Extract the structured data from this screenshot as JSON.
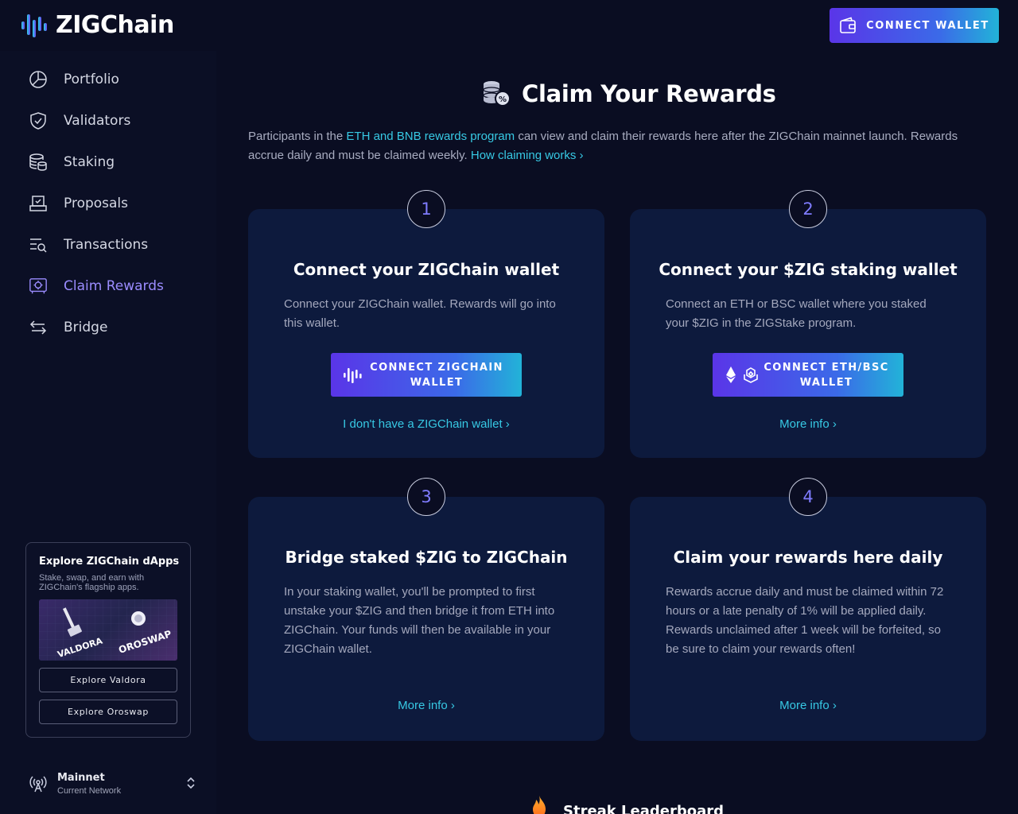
{
  "header": {
    "logo_text": "ZIGChain",
    "connect_wallet_label": "CONNECT WALLET"
  },
  "sidebar": {
    "items": [
      {
        "label": "Portfolio",
        "icon": "pie-chart-icon"
      },
      {
        "label": "Validators",
        "icon": "shield-check-icon"
      },
      {
        "label": "Staking",
        "icon": "coins-stack-icon"
      },
      {
        "label": "Proposals",
        "icon": "ballot-box-icon"
      },
      {
        "label": "Transactions",
        "icon": "list-search-icon"
      },
      {
        "label": "Claim Rewards",
        "icon": "gift-box-icon",
        "active": true
      },
      {
        "label": "Bridge",
        "icon": "arrows-swap-icon"
      }
    ],
    "dapps": {
      "title": "Explore ZIGChain dApps",
      "subtitle": "Stake, swap, and earn with ZIGChain's flagship apps.",
      "banner_left": "VALDORA",
      "banner_right": "OROSWAP",
      "explore_valdora": "Explore Valdora",
      "explore_oroswap": "Explore Oroswap"
    },
    "network": {
      "name": "Mainnet",
      "sub": "Current Network"
    }
  },
  "main": {
    "title": "Claim Your Rewards",
    "intro": {
      "p1": "Participants in the ",
      "link1": "ETH and BNB rewards program",
      "p2": " can view and claim their rewards here after the ZIGChain mainnet launch. Rewards accrue daily and must be claimed weekly. ",
      "link2": "How claiming works ›"
    },
    "steps": [
      {
        "number": "1",
        "title": "Connect your ZIGChain wallet",
        "description": "Connect your ZIGChain wallet. Rewards will go into this wallet.",
        "button_line1": "CONNECT ZIGCHAIN",
        "button_line2": "WALLET",
        "link": "I don't have a ZIGChain wallet ›"
      },
      {
        "number": "2",
        "title": "Connect your $ZIG staking wallet",
        "description": "Connect an ETH or BSC wallet where you staked your $ZIG in the ZIGStake program.",
        "button_line1": "CONNECT ETH/BSC",
        "button_line2": "WALLET",
        "link": "More info ›"
      },
      {
        "number": "3",
        "title": "Bridge staked $ZIG to ZIGChain",
        "description": "In your staking wallet, you'll be prompted to first unstake your $ZIG and then bridge it from ETH into ZIGChain. Your funds will then be available in your ZIGChain wallet.",
        "link": "More info ›"
      },
      {
        "number": "4",
        "title": "Claim your rewards here daily",
        "description": "Rewards accrue daily and must be claimed within 72 hours or a late penalty of 1% will be applied daily. Rewards unclaimed after 1 week will be forfeited, so be sure to claim your rewards often!",
        "link": "More info ›"
      }
    ],
    "streak_title": "Streak Leaderboard"
  },
  "colors": {
    "background": "#0a0d22",
    "card": "#0d1a3d",
    "accent_link": "#37c9e4",
    "accent_purple": "#7f7cff",
    "active_nav": "#9b8cff",
    "gradient_start": "#5a35e8",
    "gradient_end": "#22b3d8"
  }
}
